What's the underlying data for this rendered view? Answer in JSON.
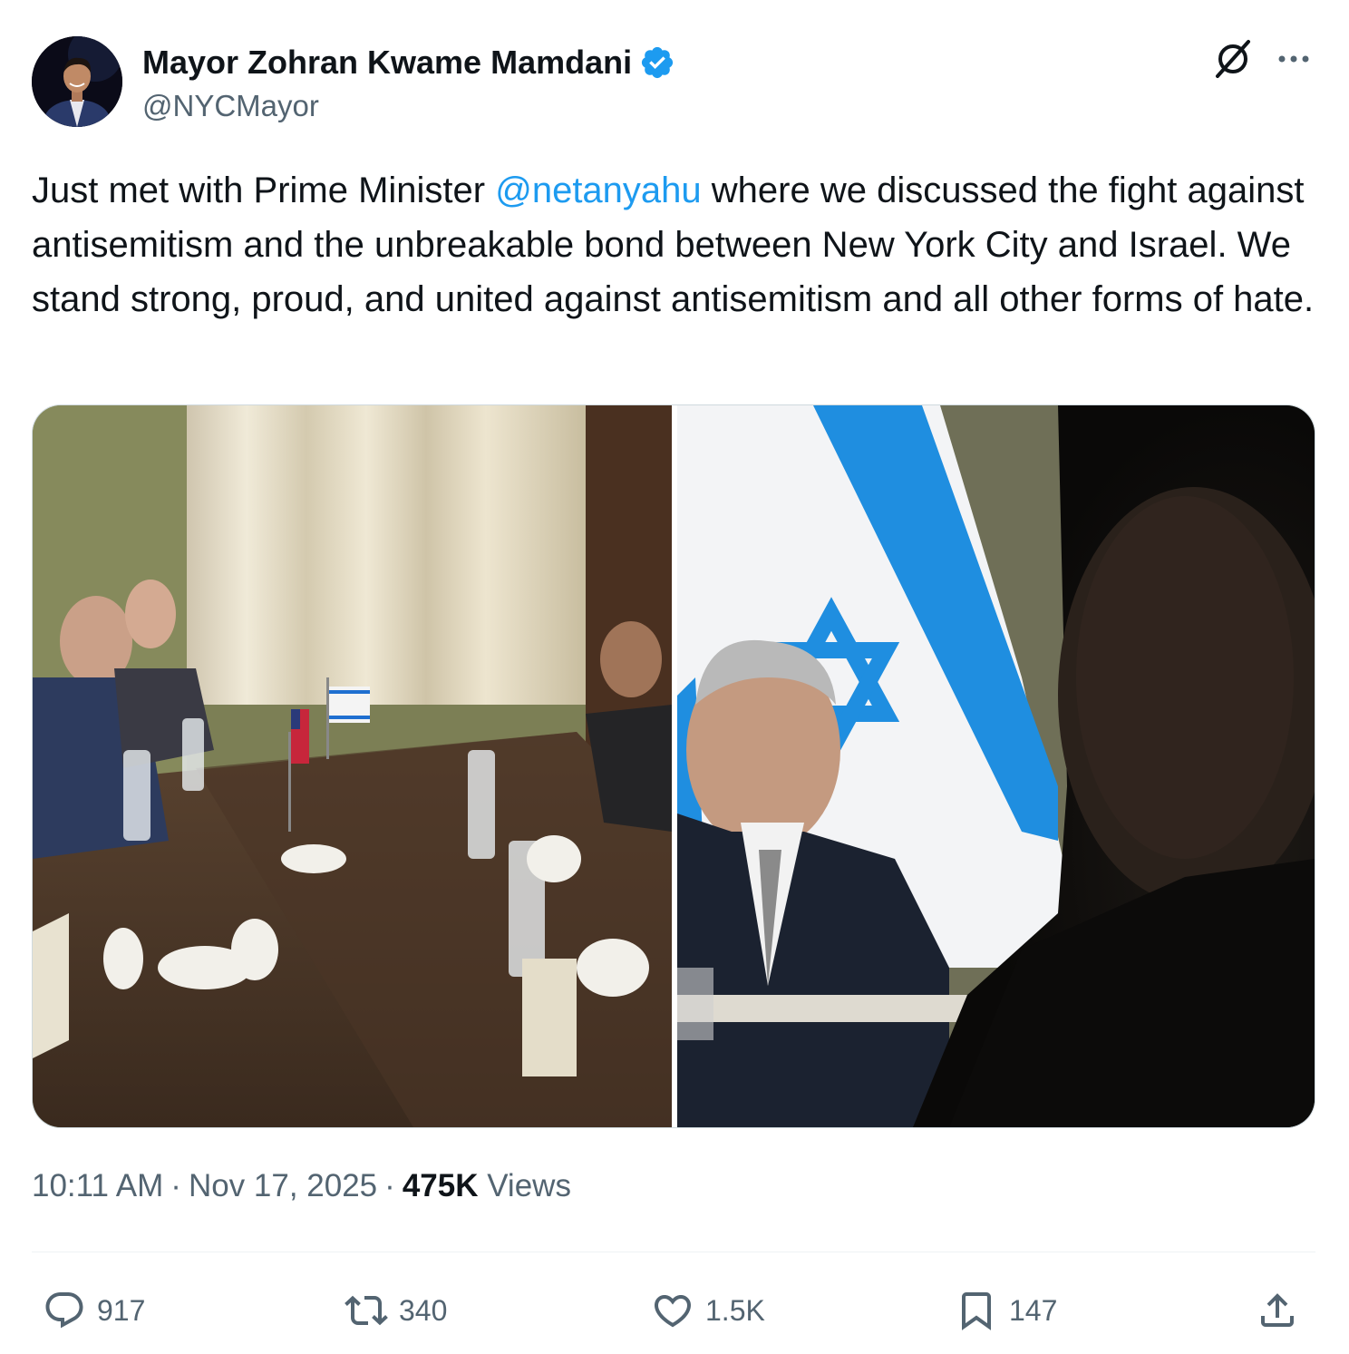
{
  "author": {
    "display_name": "Mayor Zohran Kwame Mamdani",
    "handle": "@NYCMayor",
    "verified": true
  },
  "tweet": {
    "text_before": "Just met with Prime Minister ",
    "mention": "@netanyahu",
    "text_after": " where we discussed the fight against antisemitism and the unbreakable bond between New York City and Israel. We stand strong, proud, and united against antisemitism and all other forms of hate."
  },
  "media": {
    "photo_count": 2
  },
  "meta": {
    "time": "10:11 AM",
    "separator": "·",
    "date": "Nov 17, 2025",
    "views_count": "475K",
    "views_label": "Views"
  },
  "actions": {
    "replies": "917",
    "reposts": "340",
    "likes": "1.5K",
    "bookmarks": "147"
  },
  "colors": {
    "accent": "#1d9bf0",
    "secondary_text": "#536471",
    "primary_text": "#0f1419",
    "flag_blue": "#1f8ee0"
  },
  "icons": [
    "verified-badge-icon",
    "grok-icon",
    "more-icon",
    "reply-icon",
    "repost-icon",
    "like-icon",
    "bookmark-icon",
    "share-icon"
  ]
}
